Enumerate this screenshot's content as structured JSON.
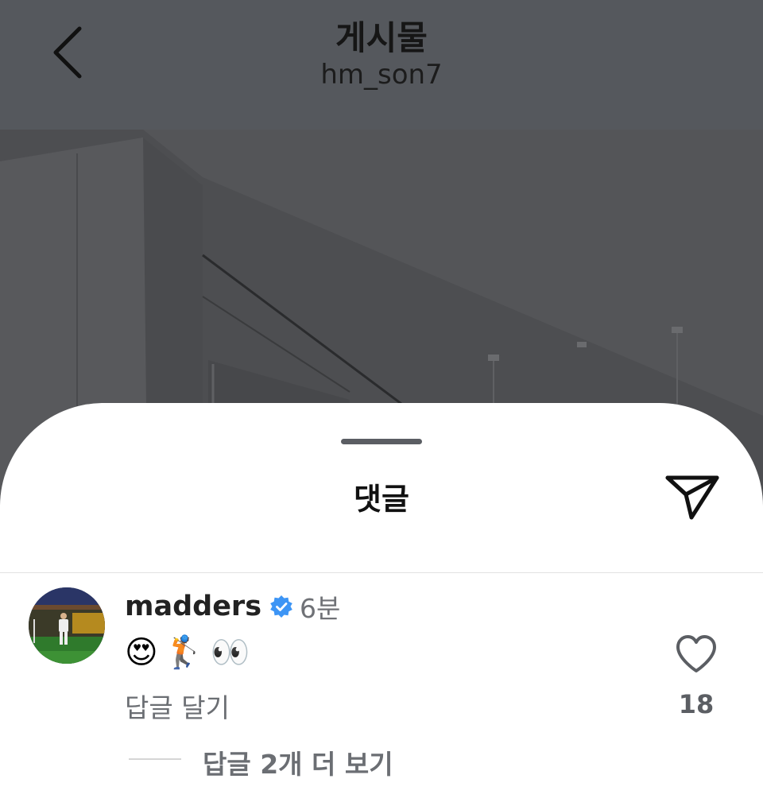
{
  "header": {
    "title": "게시물",
    "username": "hm_son7"
  },
  "sheet": {
    "title": "댓글"
  },
  "comment": {
    "username": "madders",
    "time": "6분",
    "body": "😍🏌️👀",
    "reply_label": "답글 달기",
    "like_count": "18",
    "more_replies_label": "답글 2개 더 보기"
  },
  "icons": {
    "back": "chevron-left-icon",
    "share": "paper-plane-icon",
    "verified": "verified-badge-icon",
    "like": "heart-icon"
  },
  "colors": {
    "verified": "#3d95f5",
    "topbar": "#55585d",
    "muted_text": "#6b6e73"
  }
}
